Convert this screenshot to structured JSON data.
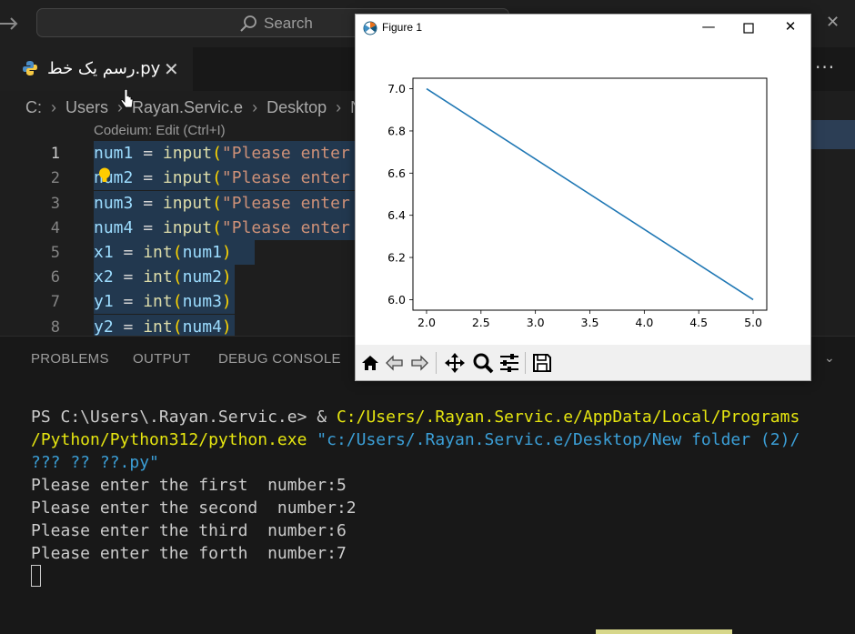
{
  "titlebar": {
    "search_placeholder": "Search"
  },
  "tab": {
    "label": "رسم یک خط.py"
  },
  "breadcrumb": [
    "C:",
    "Users",
    "Rayan.Servic.e",
    "Desktop",
    "Ne"
  ],
  "editor": {
    "codelens": "Codeium: Edit (Ctrl+I)",
    "line_numbers": [
      "1",
      "2",
      "3",
      "4",
      "5",
      "6",
      "7",
      "8"
    ],
    "lines": [
      {
        "var": "num1",
        "op": " = ",
        "fn": "input",
        "arg": "\"Please enter"
      },
      {
        "var": "num2",
        "op": " = ",
        "fn": "input",
        "arg": "\"Please enter"
      },
      {
        "var": "num3",
        "op": " = ",
        "fn": "input",
        "arg": "\"Please enter"
      },
      {
        "var": "num4",
        "op": " = ",
        "fn": "input",
        "arg": "\"Please enter"
      },
      {
        "var": "x1",
        "op": " = ",
        "fn": "int",
        "arg": "num1"
      },
      {
        "var": "x2",
        "op": " = ",
        "fn": "int",
        "arg": "num2"
      },
      {
        "var": "y1",
        "op": " = ",
        "fn": "int",
        "arg": "num3"
      },
      {
        "var": "y2",
        "op": " = ",
        "fn": "int",
        "arg": "num4"
      }
    ]
  },
  "panel": {
    "tabs": [
      "PROBLEMS",
      "OUTPUT",
      "DEBUG CONSOLE"
    ],
    "terminal": {
      "prompt": "PS C:\\Users\\.Rayan.Servic.e> & ",
      "exe_line1": "C:/Users/.Rayan.Servic.e/AppData/Local/Programs",
      "exe_line2": "/Python/Python312/python.exe",
      "arg_line1": " \"c:/Users/.Rayan.Servic.e/Desktop/New folder (2)/",
      "arg_line2": "??? ?? ??.py\"",
      "outputs": [
        "Please enter the first  number:5",
        "Please enter the second  number:2",
        "Please enter the third  number:6",
        "Please enter the forth  number:7"
      ]
    }
  },
  "figure": {
    "title": "Figure 1",
    "toolbar": [
      "home-icon",
      "back-arrow-icon",
      "forward-arrow-icon",
      "pan-icon",
      "zoom-icon",
      "configure-subplots-icon",
      "save-icon"
    ]
  },
  "chart_data": {
    "type": "line",
    "title": "",
    "xlabel": "",
    "ylabel": "",
    "x": [
      2.0,
      5.0
    ],
    "series": [
      {
        "values": [
          7.0,
          6.0
        ],
        "color": "#1f77b4"
      }
    ],
    "xlim": [
      1.875,
      5.125
    ],
    "ylim": [
      5.95,
      7.05
    ],
    "xticks": [
      "2.0",
      "2.5",
      "3.0",
      "3.5",
      "4.0",
      "4.5",
      "5.0"
    ],
    "yticks": [
      "6.0",
      "6.2",
      "6.4",
      "6.6",
      "6.8",
      "7.0"
    ],
    "grid": false
  }
}
